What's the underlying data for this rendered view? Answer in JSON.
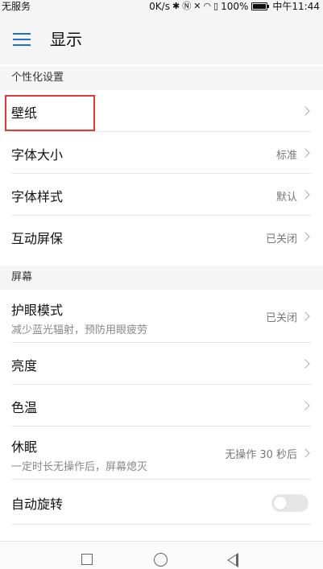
{
  "status_bar": {
    "carrier": "无服务",
    "network_speed": "0K/s",
    "icons": [
      "bluetooth-icon",
      "nfc-icon",
      "mute-icon",
      "wifi-icon",
      "sim-icon",
      "battery-icon"
    ],
    "battery_text": "100%",
    "battery_level": 100,
    "time": "中午11:44"
  },
  "app_bar": {
    "title": "显示",
    "menu_icon": "hamburger-menu-icon",
    "accent_color": "#1e6ed8"
  },
  "sections": [
    {
      "header": "个性化设置",
      "items": [
        {
          "label": "壁纸",
          "value": "",
          "highlighted": true
        },
        {
          "label": "字体大小",
          "value": "标准"
        },
        {
          "label": "字体样式",
          "value": "默认"
        },
        {
          "label": "互动屏保",
          "value": "已关闭"
        }
      ]
    },
    {
      "header": "屏幕",
      "items": [
        {
          "label": "护眼模式",
          "subtitle": "减少蓝光辐射，预防用眼疲劳",
          "value": "已关闭"
        },
        {
          "label": "亮度",
          "value": ""
        },
        {
          "label": "色温",
          "value": ""
        },
        {
          "label": "休眠",
          "subtitle": "一定时长无操作后，屏幕熄灭",
          "value": "无操作 30 秒后"
        },
        {
          "label": "自动旋转",
          "toggle": false
        }
      ]
    }
  ],
  "highlight_color": "#e53935",
  "nav_bar": {
    "buttons": [
      "recent-apps-icon",
      "home-icon",
      "back-icon"
    ]
  }
}
